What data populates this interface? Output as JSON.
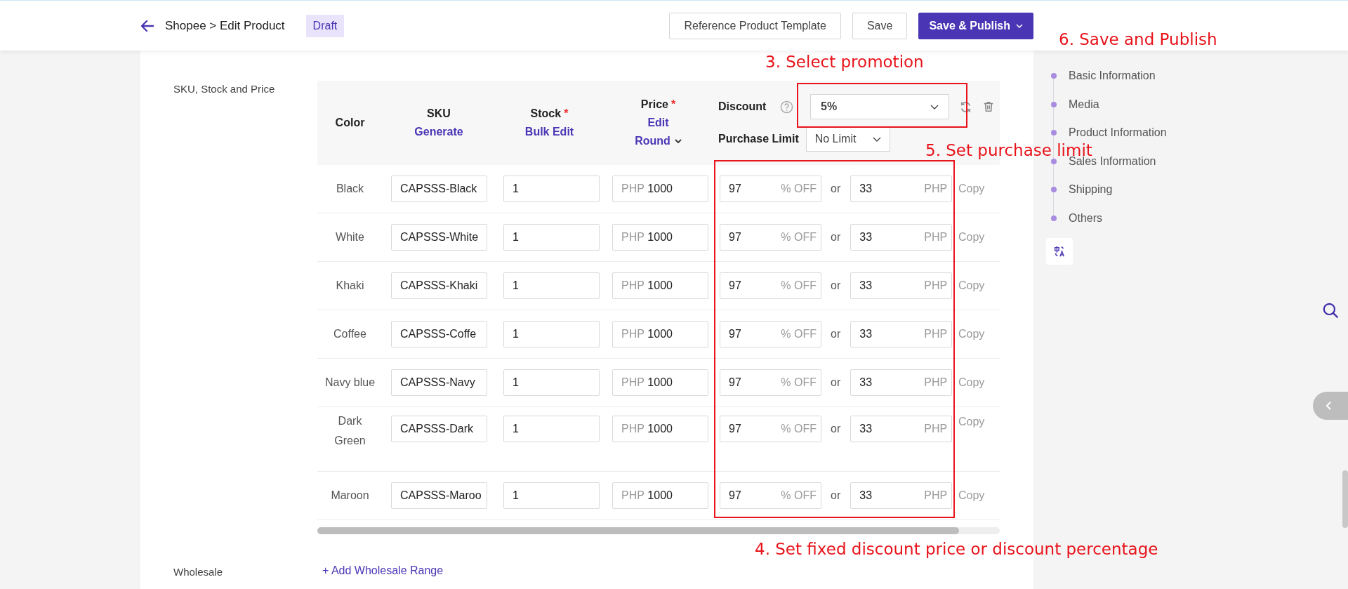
{
  "header": {
    "breadcrumb": "Shopee > Edit Product",
    "status_badge": "Draft",
    "buttons": [
      {
        "label": "Reference Product Template",
        "kind": "outline"
      },
      {
        "label": "Save",
        "kind": "outline"
      },
      {
        "label": "Save & Publish",
        "kind": "primary"
      }
    ]
  },
  "section_label": "SKU, Stock and Price",
  "table": {
    "columns": [
      {
        "label": "Color"
      },
      {
        "label": "SKU",
        "links": [
          "Generate"
        ]
      },
      {
        "label": "Stock",
        "required_mark": "*",
        "links": [
          "Bulk Edit"
        ]
      },
      {
        "label": "Price",
        "required_mark": "*",
        "links": [
          "Edit",
          "Round"
        ]
      }
    ],
    "discount_label": "Discount",
    "discount_select": "5%",
    "purchase_limit_label": "Purchase Limit",
    "purchase_limit_select": "No Limit",
    "rows": [
      {
        "variant": "Black",
        "sku": "CAPSSS-Black",
        "stock": "1",
        "price_unit": "PHP",
        "price": "1000",
        "discount": "97",
        "discount_unit": "% OFF",
        "or": "or",
        "discount_price": "33",
        "discount_price_unit": "PHP",
        "copy": "Copy"
      },
      {
        "variant": "White",
        "sku": "CAPSSS-White",
        "stock": "1",
        "price_unit": "PHP",
        "price": "1000",
        "discount": "97",
        "discount_unit": "% OFF",
        "or": "or",
        "discount_price": "33",
        "discount_price_unit": "PHP",
        "copy": "Copy"
      },
      {
        "variant": "Khaki",
        "sku": "CAPSSS-Khaki",
        "stock": "1",
        "price_unit": "PHP",
        "price": "1000",
        "discount": "97",
        "discount_unit": "% OFF",
        "or": "or",
        "discount_price": "33",
        "discount_price_unit": "PHP",
        "copy": "Copy"
      },
      {
        "variant": "Coffee",
        "sku": "CAPSSS-Coffe",
        "stock": "1",
        "price_unit": "PHP",
        "price": "1000",
        "discount": "97",
        "discount_unit": "% OFF",
        "or": "or",
        "discount_price": "33",
        "discount_price_unit": "PHP",
        "copy": "Copy"
      },
      {
        "variant": "Navy blue",
        "sku": "CAPSSS-Navy",
        "stock": "1",
        "price_unit": "PHP",
        "price": "1000",
        "discount": "97",
        "discount_unit": "% OFF",
        "or": "or",
        "discount_price": "33",
        "discount_price_unit": "PHP",
        "copy": "Copy"
      },
      {
        "variant": "Dark Green",
        "sku": "CAPSSS-Dark",
        "stock": "1",
        "price_unit": "PHP",
        "price": "1000",
        "discount": "97",
        "discount_unit": "% OFF",
        "or": "or",
        "discount_price": "33",
        "discount_price_unit": "PHP",
        "copy": "Copy"
      },
      {
        "variant": "Maroon",
        "sku": "CAPSSS-Maroo",
        "stock": "1",
        "price_unit": "PHP",
        "price": "1000",
        "discount": "97",
        "discount_unit": "% OFF",
        "or": "or",
        "discount_price": "33",
        "discount_price_unit": "PHP",
        "copy": "Copy"
      }
    ]
  },
  "wholesale": {
    "label": "Wholesale",
    "link": "+ Add Wholesale Range"
  },
  "section_nav": [
    "Basic Information",
    "Media",
    "Product Information",
    "Sales Information",
    "Shipping",
    "Others"
  ],
  "annotations": [
    "6. Save and Publish",
    "3. Select promotion",
    "5. Set purchase limit",
    "4. Set fixed discount price or discount percentage"
  ]
}
